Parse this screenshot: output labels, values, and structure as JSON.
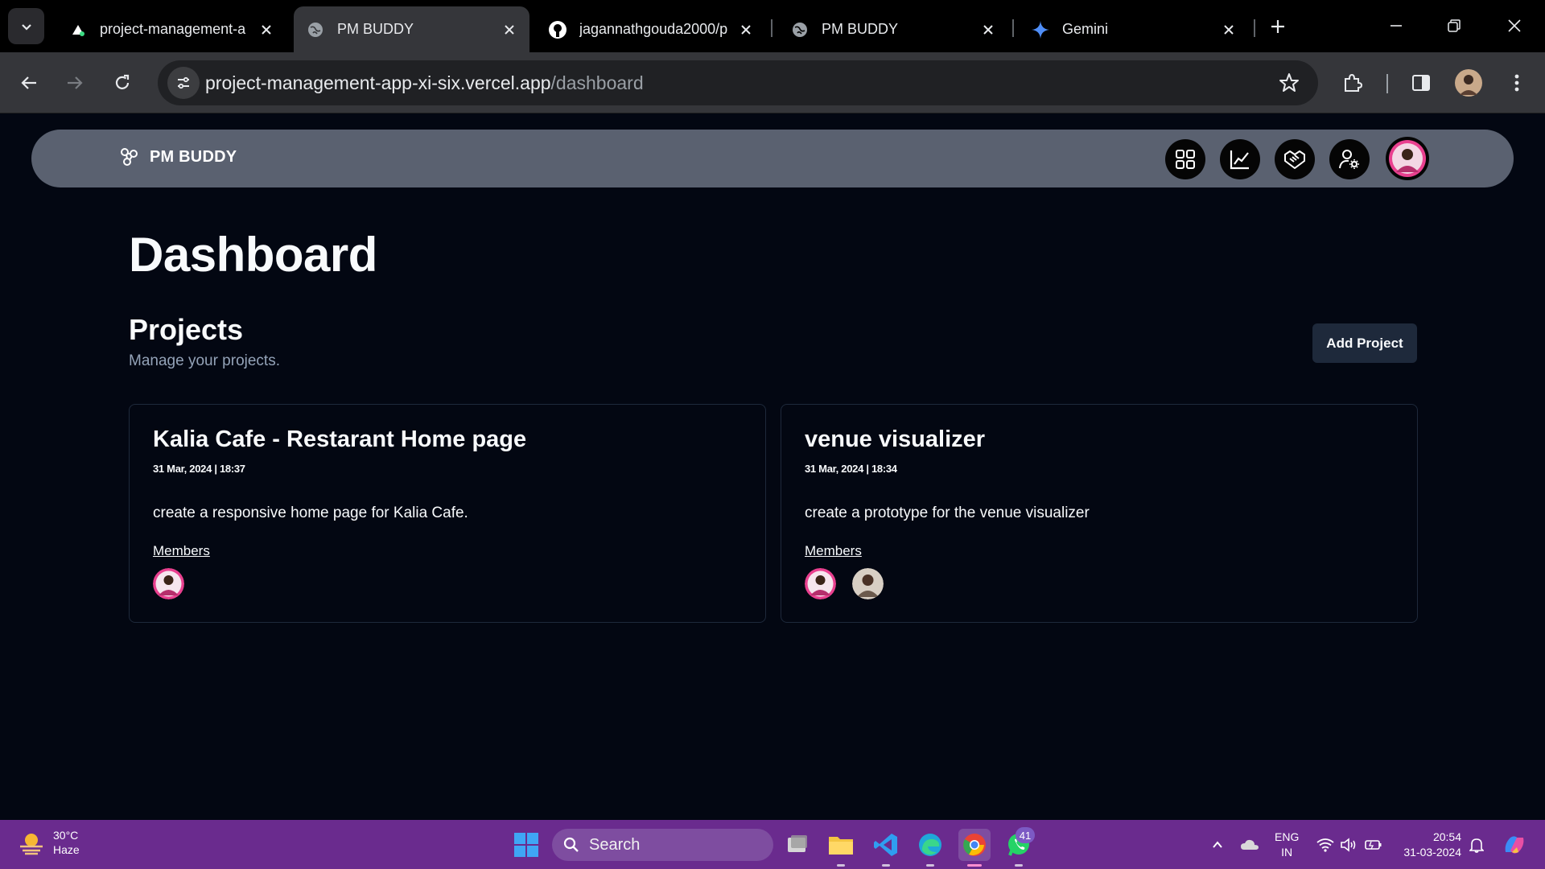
{
  "browser": {
    "tabs": [
      {
        "title": "project-management-a",
        "icon": "vercel-icon",
        "active": false
      },
      {
        "title": "PM BUDDY",
        "icon": "globe-icon",
        "active": true
      },
      {
        "title": "jagannathgouda2000/p",
        "icon": "github-icon",
        "active": false
      },
      {
        "title": "PM BUDDY",
        "icon": "globe-icon",
        "active": false
      },
      {
        "title": "Gemini",
        "icon": "gemini-icon",
        "active": false
      }
    ],
    "url": {
      "host": "project-management-app-xi-six.vercel.app",
      "path": "/dashboard"
    }
  },
  "app": {
    "brand": "PM BUDDY",
    "nav": [
      {
        "name": "dashboard",
        "icon": "grid-icon"
      },
      {
        "name": "analytics",
        "icon": "chart-line-icon"
      },
      {
        "name": "collaboration",
        "icon": "handshake-icon"
      },
      {
        "name": "user-settings",
        "icon": "user-gear-icon"
      }
    ]
  },
  "dashboard": {
    "title": "Dashboard",
    "section_title": "Projects",
    "section_subtitle": "Manage your projects.",
    "add_project_label": "Add Project",
    "members_label": "Members",
    "projects": [
      {
        "title": "Kalia Cafe - Restarant Home page",
        "date": "31 Mar, 2024 | 18:37",
        "description": "create a responsive home page for Kalia Cafe.",
        "member_count": 1
      },
      {
        "title": "venue visualizer",
        "date": "31 Mar, 2024 | 18:34",
        "description": "create a prototype for the venue visualizer",
        "member_count": 2
      }
    ]
  },
  "taskbar": {
    "weather_temp": "30°C",
    "weather_desc": "Haze",
    "search_label": "Search",
    "whatsapp_badge": "41",
    "lang_top": "ENG",
    "lang_bottom": "IN",
    "time": "20:54",
    "date": "31-03-2024"
  },
  "colors": {
    "page_bg": "#030712",
    "navbar_bg": "#5a6170",
    "card_border": "#1e293b",
    "button_bg": "#1e293b",
    "avatar_ring": "#e9408f",
    "taskbar_bg": "#6a2b8e"
  }
}
